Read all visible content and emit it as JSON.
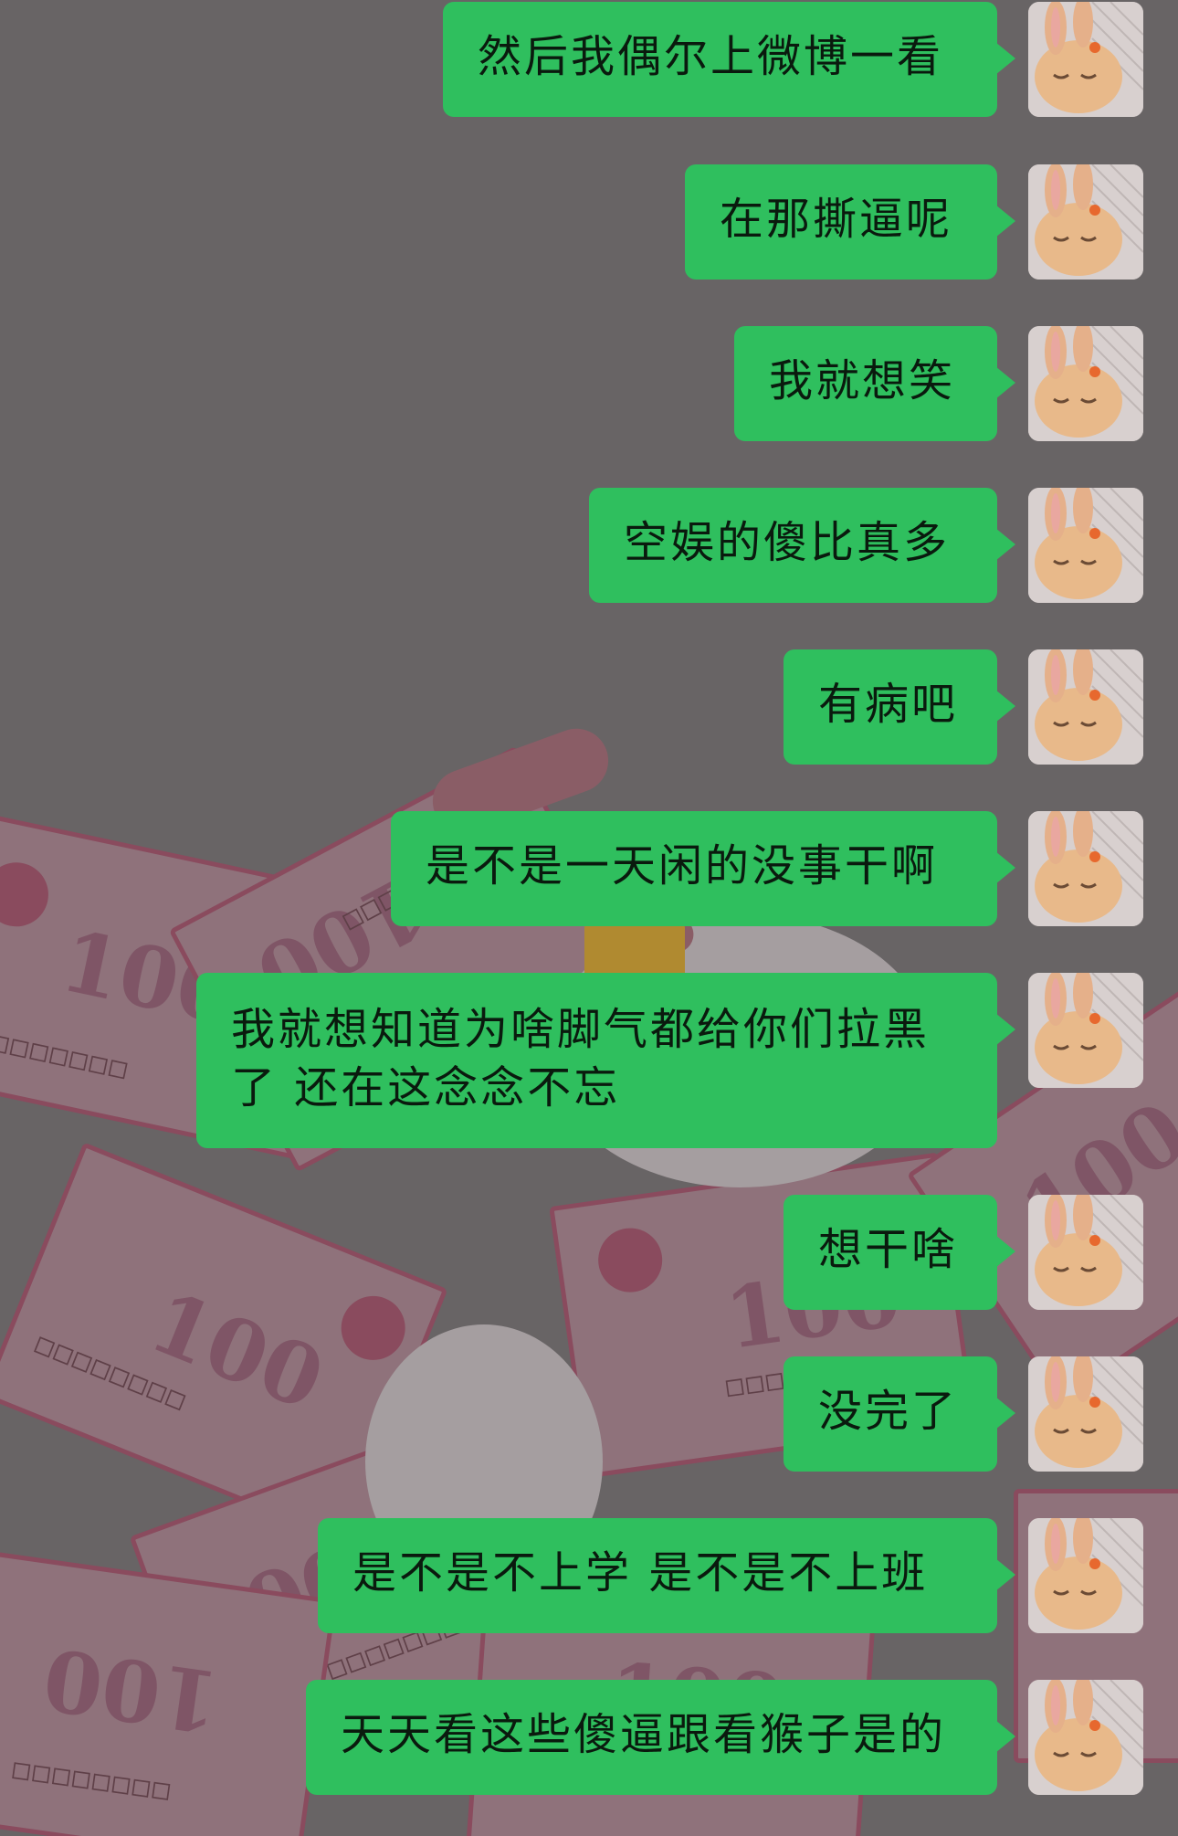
{
  "chat": {
    "messages": [
      {
        "sender": "me",
        "text": "然后我偶尔上微博一看"
      },
      {
        "sender": "me",
        "text": "在那撕逼呢"
      },
      {
        "sender": "me",
        "text": "我就想笑"
      },
      {
        "sender": "me",
        "text": "空娱的傻比真多"
      },
      {
        "sender": "me",
        "text": "有病吧"
      },
      {
        "sender": "me",
        "text": "是不是一天闲的没事干啊"
      },
      {
        "sender": "me",
        "text": "我就想知道为啥脚气都给你们拉黑了  还在这念念不忘"
      },
      {
        "sender": "me",
        "text": "想干啥"
      },
      {
        "sender": "me",
        "text": "没完了"
      },
      {
        "sender": "me",
        "text": "是不是不上学  是不是不上班"
      },
      {
        "sender": "me",
        "text": "天天看这些傻逼跟看猴子是的"
      }
    ]
  },
  "colors": {
    "bubble": "#2fbf5e",
    "background": "#686465"
  },
  "wallpaper": {
    "banknote_value": "100",
    "serial": "□□□□□□□□"
  },
  "avatar_icon": "bunny-avatar-icon"
}
